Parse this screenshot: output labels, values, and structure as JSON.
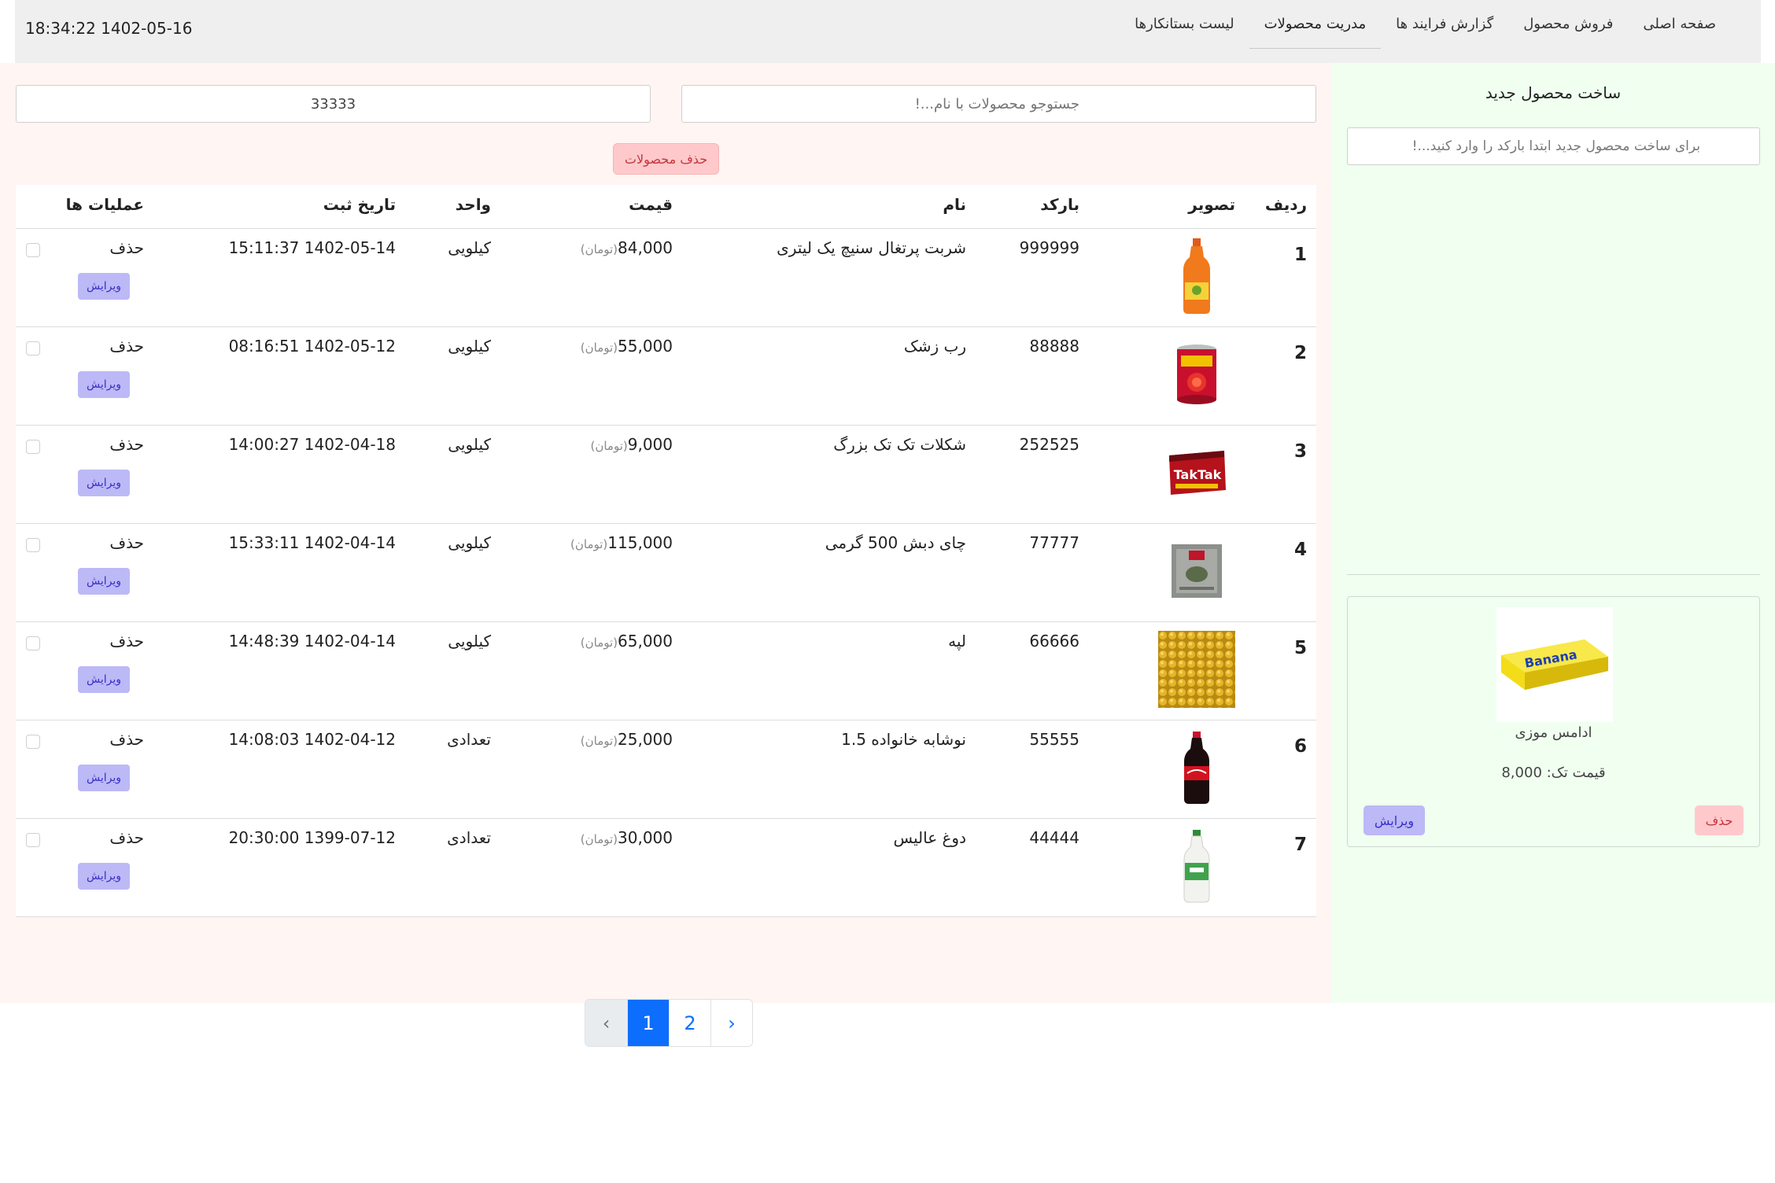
{
  "header": {
    "datetime": "18:34:22 1402-05-16",
    "nav": [
      {
        "label": "صفحه اصلی"
      },
      {
        "label": "فروش محصول"
      },
      {
        "label": "گزارش فرایند ها"
      },
      {
        "label": "مدریت محصولات",
        "active": true
      },
      {
        "label": "لیست بستانکارها"
      }
    ]
  },
  "toolbar": {
    "search_placeholder": "جستوجو محصولات با نام...!",
    "barcode_value": "33333",
    "delete_products_label": "حذف محصولات"
  },
  "table": {
    "headers": {
      "index": "ردیف",
      "image": "تصویر",
      "barcode": "بارکد",
      "name": "نام",
      "price": "قیمت",
      "unit": "واحد",
      "date": "تاریخ ثبت",
      "actions": "عملیات ها"
    },
    "currency_label": "(تومان)",
    "delete_label": "حذف",
    "edit_label": "ویرایش",
    "rows": [
      {
        "index": "1",
        "image_icon": "orange-juice-bottle-icon",
        "barcode": "999999",
        "name": "شربت پرتغال سنیچ یک لیتری",
        "price": "84,000",
        "unit": "کیلویی",
        "date": "15:11:37 1402-05-14"
      },
      {
        "index": "2",
        "image_icon": "tomato-paste-can-icon",
        "barcode": "88888",
        "name": "رب زشک",
        "price": "55,000",
        "unit": "کیلویی",
        "date": "08:16:51 1402-05-12"
      },
      {
        "index": "3",
        "image_icon": "chocolate-bar-icon",
        "barcode": "252525",
        "name": "شکلات تک تک بزرگ",
        "price": "9,000",
        "unit": "کیلویی",
        "date": "14:00:27 1402-04-18"
      },
      {
        "index": "4",
        "image_icon": "tea-package-icon",
        "barcode": "77777",
        "name": "چای دبش 500 گرمی",
        "price": "115,000",
        "unit": "کیلویی",
        "date": "15:33:11 1402-04-14"
      },
      {
        "index": "5",
        "image_icon": "split-peas-icon",
        "barcode": "66666",
        "name": "لپه",
        "price": "65,000",
        "unit": "کیلویی",
        "date": "14:48:39 1402-04-14"
      },
      {
        "index": "6",
        "image_icon": "cola-bottle-icon",
        "barcode": "55555",
        "name": "نوشابه خانواده 1.5",
        "price": "25,000",
        "unit": "تعدادی",
        "date": "14:08:03 1402-04-12"
      },
      {
        "index": "7",
        "image_icon": "doogh-bottle-icon",
        "barcode": "44444",
        "name": "دوغ عالیس",
        "price": "30,000",
        "unit": "تعدادی",
        "date": "20:30:00 1399-07-12"
      }
    ]
  },
  "pagination": {
    "prev": "‹",
    "pages": [
      "1",
      "2"
    ],
    "current": "1",
    "next": "›"
  },
  "sidebar": {
    "title": "ساخت محصول جدید",
    "barcode_placeholder": "برای ساخت محصول جدید ابتدا بارکد را وارد کنید...!",
    "card": {
      "image_icon": "banana-gum-icon",
      "name": "ادامس موزی",
      "price_text": "قیمت تک: 8,000",
      "delete_label": "حذف",
      "edit_label": "ویرایش"
    }
  }
}
